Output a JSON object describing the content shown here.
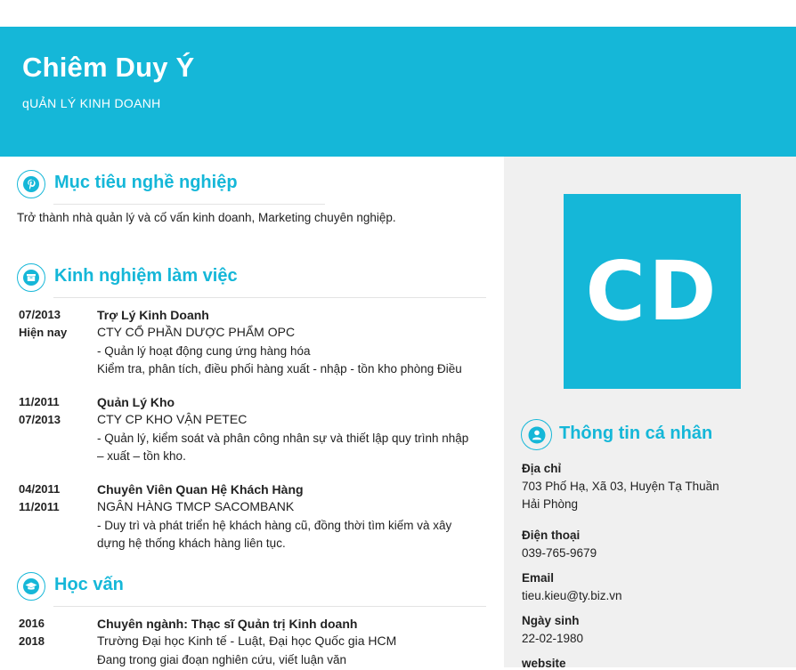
{
  "header": {
    "name": "Chiêm Duy Ý",
    "role": "qUẢN LÝ KINH DOANH"
  },
  "objective": {
    "title": "Mục tiêu nghề nghiệp",
    "icon": "pinterest-icon",
    "text": "Trở thành nhà quản  lý và cố vấn kinh doanh, Marketing chuyên nghiệp."
  },
  "experience": {
    "title": "Kinh nghiệm làm việc",
    "icon": "archive-box-icon",
    "items": [
      {
        "date_from": "07/2013",
        "date_to": "Hiện nay",
        "title": "Trợ Lý Kinh Doanh",
        "org": "CTY CỔ PHẦN DƯỢC PHẨM OPC",
        "desc": "- Quản lý hoạt động cung ứng hàng hóa\nKiểm tra, phân tích, điều phối hàng xuất - nhập - tồn kho phòng Điều"
      },
      {
        "date_from": "11/2011",
        "date_to": "07/2013",
        "title": "Quản Lý Kho",
        "org": "CTY CP KHO VẬN PETEC",
        "desc": "- Quản lý, kiểm soát và phân công nhân sự và thiết lập quy trình nhập\n– xuất – tồn kho."
      },
      {
        "date_from": "04/2011",
        "date_to": "11/2011",
        "title": "Chuyên Viên Quan Hệ Khách Hàng",
        "org": "NGÂN HÀNG TMCP SACOMBANK",
        "desc": "- Duy trì và phát triển hệ khách hàng cũ, đồng thời tìm kiếm và xây\ndựng hệ thống khách hàng liên tục."
      }
    ]
  },
  "education": {
    "title": "Học vấn",
    "icon": "graduation-cap-icon",
    "items": [
      {
        "date_from": "2016",
        "date_to": "2018",
        "title": "Chuyên ngành: Thạc sĩ Quản trị Kinh doanh",
        "org": "Trường Đại học Kinh tế - Luật, Đại học Quốc gia HCM",
        "desc": "Đang trong giai đoạn nghiên cứu, viết luận văn"
      }
    ]
  },
  "sidebar": {
    "avatar_initials": "CD",
    "personal_title": "Thông tin cá nhân",
    "personal_icon": "user-icon",
    "fields": [
      {
        "label": "Địa chỉ",
        "value": "703 Phố Hạ, Xã 03, Huyện Tạ Thuần\nHải Phòng"
      },
      {
        "label": "Điện thoại",
        "value": "039-765-9679"
      },
      {
        "label": "Email",
        "value": "tieu.kieu@ty.biz.vn"
      },
      {
        "label": "Ngày sinh",
        "value": "22-02-1980"
      },
      {
        "label": "website",
        "value": ""
      }
    ]
  },
  "colors": {
    "accent": "#15b7d8",
    "sidebar_bg": "#f0f0f0",
    "text": "#222222"
  }
}
